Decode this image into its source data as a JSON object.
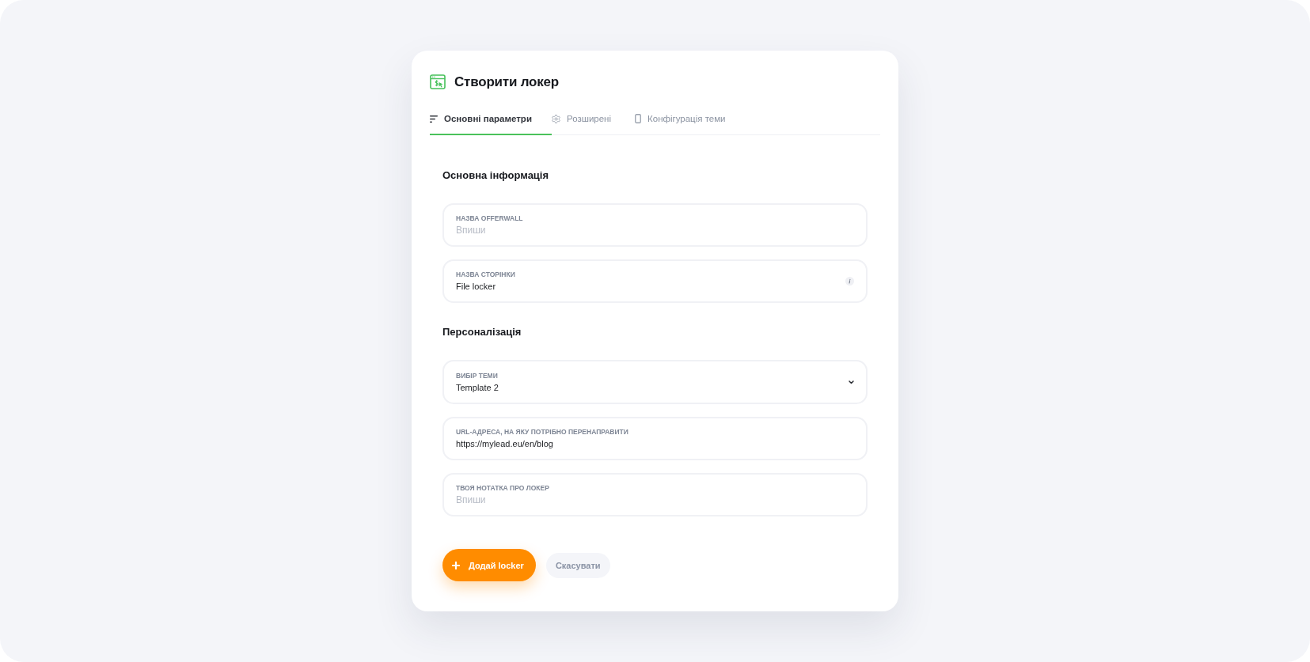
{
  "header": {
    "title": "Створити локер"
  },
  "tabs": [
    {
      "label": "Основні параметри",
      "selected": true
    },
    {
      "label": "Розширені",
      "selected": false
    },
    {
      "label": "Конфігурація теми",
      "selected": false
    }
  ],
  "sections": [
    {
      "heading": "Основна інформація",
      "fields": [
        {
          "kind": "text",
          "label": "НАЗВА OFFERWALL",
          "placeholder": "Впиши"
        },
        {
          "kind": "hinted",
          "label": "НАЗВА СТОРІНКИ",
          "value": "File locker"
        }
      ]
    },
    {
      "heading": "Персоналізація",
      "fields": [
        {
          "kind": "select",
          "label": "ВИБІР ТЕМИ",
          "value": "Template 2"
        },
        {
          "kind": "text",
          "label": "URL-АДРЕСА, НА ЯКУ ПОТРІБНО ПЕРЕНАПРАВИТИ",
          "value": "https://mylead.eu/en/blog"
        },
        {
          "kind": "text",
          "label": "ТВОЯ НОТАТКА ПРО ЛОКЕР",
          "placeholder": "Впиши"
        }
      ]
    }
  ],
  "buttons": [
    {
      "kind": "primary",
      "label": "Додай locker"
    },
    {
      "kind": "secondary",
      "label": "Скасувати"
    }
  ]
}
